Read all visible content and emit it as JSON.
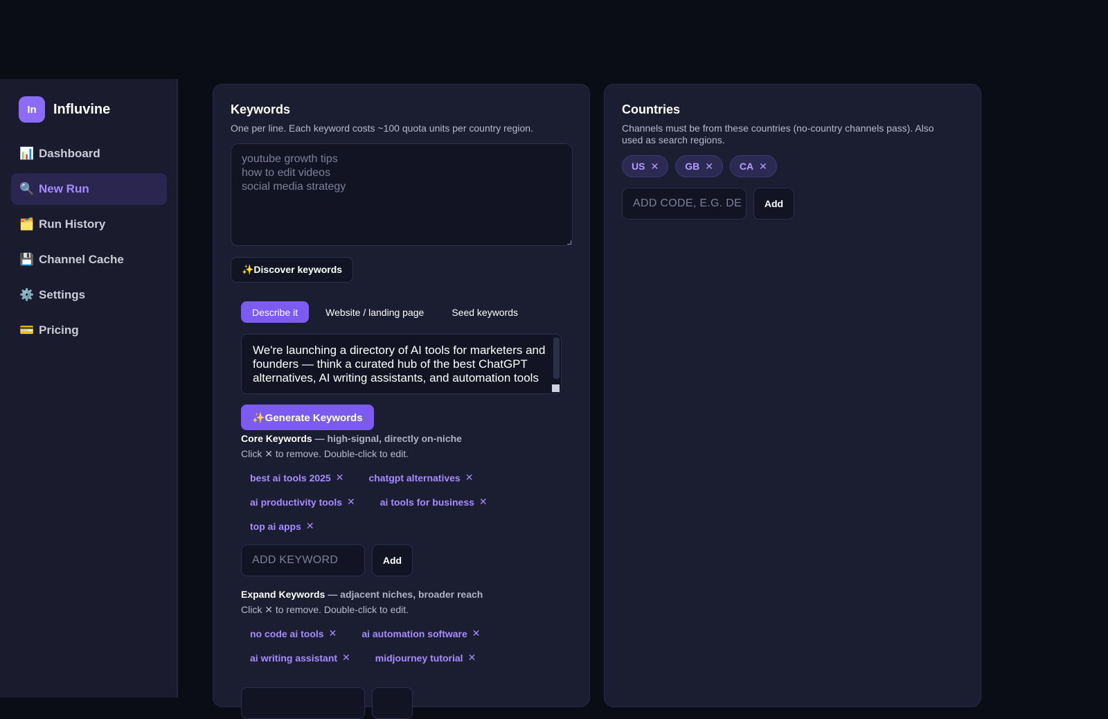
{
  "brand": {
    "badge": "In",
    "name": "Influvine"
  },
  "nav": [
    {
      "icon": "📊",
      "label": "Dashboard"
    },
    {
      "icon": "🔍",
      "label": "New Run"
    },
    {
      "icon": "🗂️",
      "label": "Run History"
    },
    {
      "icon": "💾",
      "label": "Channel Cache"
    },
    {
      "icon": "⚙️",
      "label": "Settings"
    },
    {
      "icon": "💳",
      "label": "Pricing"
    }
  ],
  "keywords": {
    "title": "Keywords",
    "subtitle": "One per line. Each keyword costs ~100 quota units per country region.",
    "textarea_placeholder": "youtube growth tips\nhow to edit videos\nsocial media strategy",
    "discover_label": "✨Discover keywords",
    "tabs": [
      "Describe it",
      "Website / landing page",
      "Seed keywords"
    ],
    "description": "We're launching a directory of AI tools for marketers and founders — think a curated hub of the best ChatGPT alternatives, AI writing assistants, and automation tools",
    "generate_label": "✨Generate Keywords",
    "core": {
      "title": "Core Keywords",
      "subtitle": " — high-signal, directly on-niche",
      "help": "Click ✕ to remove. Double-click to edit.",
      "rows": [
        [
          "best ai tools 2025",
          "chatgpt alternatives"
        ],
        [
          "ai productivity tools",
          "ai tools for business"
        ],
        [
          "top ai apps"
        ]
      ],
      "input_placeholder": "ADD KEYWORD",
      "add_label": "Add"
    },
    "expand": {
      "title": "Expand Keywords",
      "subtitle": " — adjacent niches, broader reach",
      "help": "Click ✕ to remove. Double-click to edit.",
      "rows": [
        [
          "no code ai tools",
          "ai automation software"
        ],
        [
          "ai writing assistant",
          "midjourney tutorial"
        ]
      ]
    }
  },
  "countries": {
    "title": "Countries",
    "subtitle": "Channels must be from these countries (no-country channels pass). Also used as search regions.",
    "codes": [
      "US",
      "GB",
      "CA"
    ],
    "input_placeholder": "ADD CODE, E.G. DE",
    "add_label": "Add"
  },
  "remove_glyph": "✕"
}
